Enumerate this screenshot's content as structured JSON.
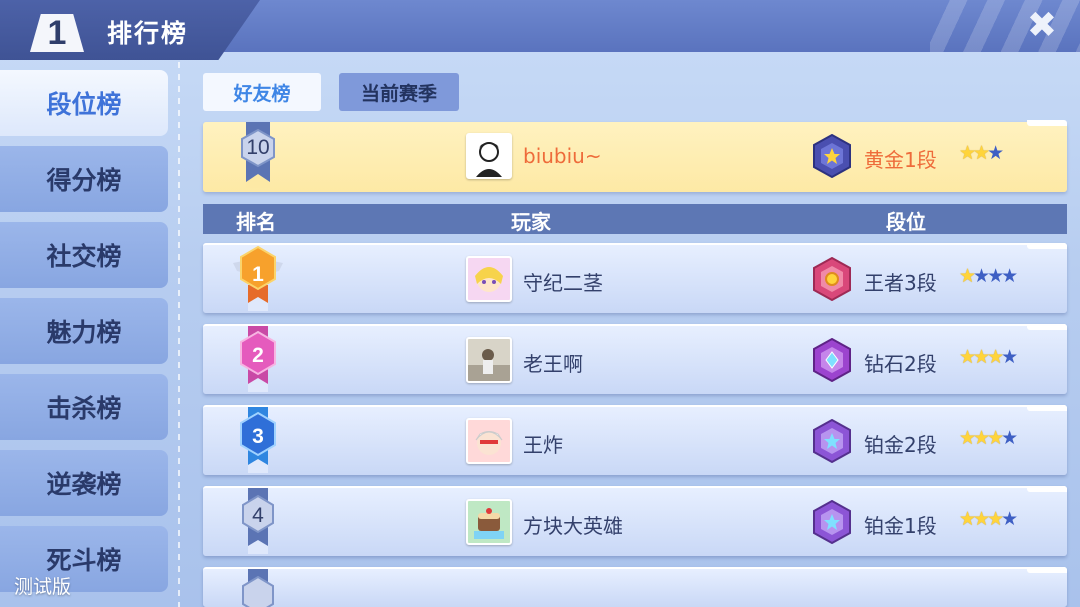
{
  "header": {
    "badge_number": "1",
    "title": "排行榜",
    "close_icon": "close-icon"
  },
  "sidebar": {
    "items": [
      {
        "label": "段位榜",
        "active": true
      },
      {
        "label": "得分榜",
        "active": false
      },
      {
        "label": "社交榜",
        "active": false
      },
      {
        "label": "魅力榜",
        "active": false
      },
      {
        "label": "击杀榜",
        "active": false
      },
      {
        "label": "逆袭榜",
        "active": false
      },
      {
        "label": "死斗榜",
        "active": false
      }
    ],
    "watermark": "测试版"
  },
  "tabs": [
    {
      "label": "好友榜",
      "active": true
    },
    {
      "label": "当前赛季",
      "active": false
    }
  ],
  "self": {
    "rank": "10",
    "name": "biubiu~",
    "tier": "黄金1段",
    "stars_filled": 2,
    "stars_total": 3
  },
  "columns": {
    "rank": "排名",
    "player": "玩家",
    "tier": "段位"
  },
  "rows": [
    {
      "rank": "1",
      "name": "守纪二茎",
      "tier": "王者3段",
      "stars_filled": 1,
      "stars_total": 4,
      "badge_color": "#f08a2a",
      "emblem_color": "#e0527a"
    },
    {
      "rank": "2",
      "name": "老王啊",
      "tier": "钻石2段",
      "stars_filled": 3,
      "stars_total": 4,
      "badge_color": "#d94db0",
      "emblem_color": "#b04ad6"
    },
    {
      "rank": "3",
      "name": "王炸",
      "tier": "铂金2段",
      "stars_filled": 3,
      "stars_total": 4,
      "badge_color": "#2f8be0",
      "emblem_color": "#8b54d6"
    },
    {
      "rank": "4",
      "name": "方块大英雄",
      "tier": "铂金1段",
      "stars_filled": 3,
      "stars_total": 4,
      "badge_color": "#5b74b4",
      "emblem_color": "#8b54d6"
    }
  ],
  "colors": {
    "accent": "#3f86e6",
    "highlight_name": "#ee6b3a",
    "header": "#5a73be"
  }
}
